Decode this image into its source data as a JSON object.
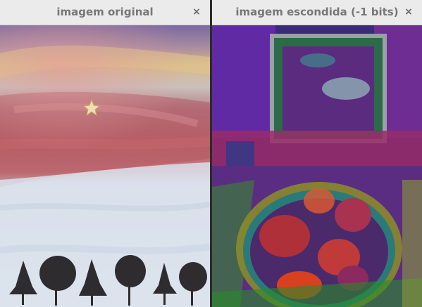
{
  "windows": [
    {
      "title": "imagem original",
      "close_icon": "close-icon",
      "image": "painting of pink and purple sunset sky with star over white snow field and row of dark trees"
    },
    {
      "title": "imagem escondida (-1 bits)",
      "close_icon": "close-icon",
      "image": "psychedelic false-color painting of a table with a bowl of round fruit and framed window"
    }
  ],
  "icons": {
    "close": "×"
  },
  "colors": {
    "titlebar": "#ebebeb",
    "title_text": "#777777",
    "divider": "#2b2b2b"
  }
}
